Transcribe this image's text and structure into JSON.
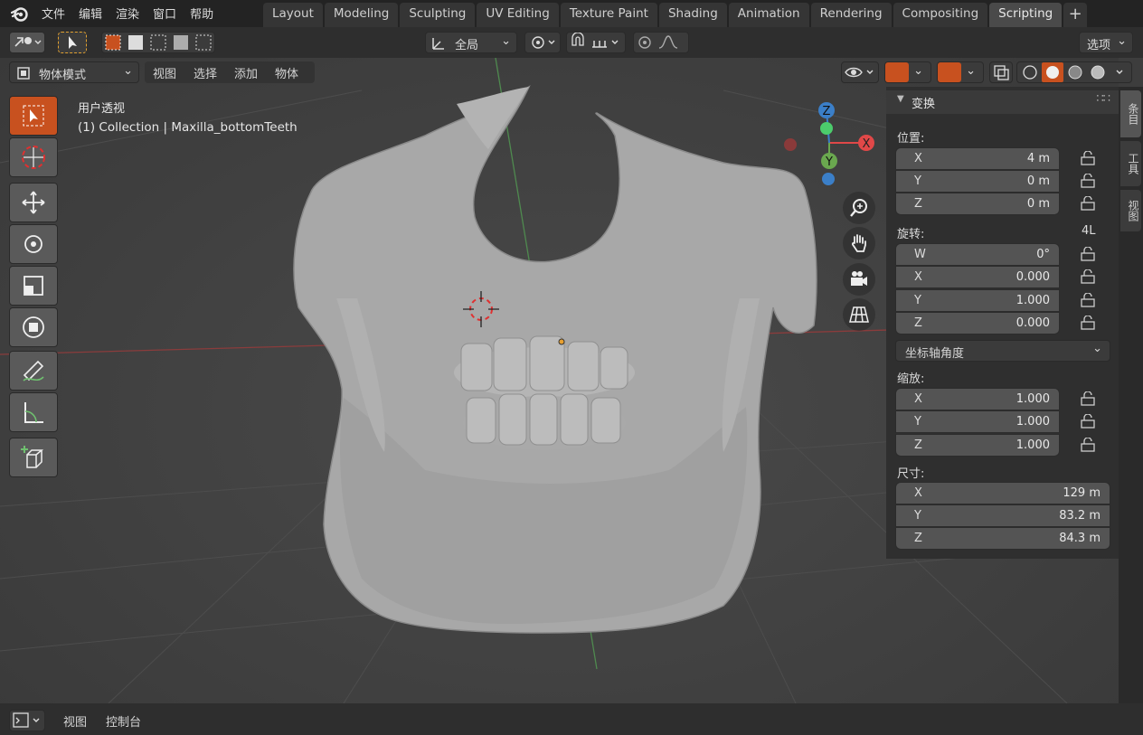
{
  "top_menu": [
    "文件",
    "编辑",
    "渲染",
    "窗口",
    "帮助"
  ],
  "workspace_tabs": [
    {
      "label": "Layout",
      "active": false
    },
    {
      "label": "Modeling",
      "active": false
    },
    {
      "label": "Sculpting",
      "active": false
    },
    {
      "label": "UV Editing",
      "active": false
    },
    {
      "label": "Texture Paint",
      "active": false
    },
    {
      "label": "Shading",
      "active": false
    },
    {
      "label": "Animation",
      "active": false
    },
    {
      "label": "Rendering",
      "active": false
    },
    {
      "label": "Compositing",
      "active": false
    },
    {
      "label": "Scripting",
      "active": true
    }
  ],
  "header": {
    "transform_orientation": "全局",
    "options_label": "选项"
  },
  "viewport_header": {
    "mode": "物体模式",
    "menus": [
      "视图",
      "选择",
      "添加",
      "物体"
    ]
  },
  "overlay": {
    "view_name": "用户透视",
    "collection_info": "(1) Collection | Maxilla_bottomTeeth"
  },
  "gizmo": {
    "x": "X",
    "y": "Y",
    "z": "Z"
  },
  "transform_panel": {
    "title": "变换",
    "location_label": "位置:",
    "location": [
      {
        "axis": "X",
        "value": "4 m"
      },
      {
        "axis": "Y",
        "value": "0 m"
      },
      {
        "axis": "Z",
        "value": "0 m"
      }
    ],
    "rotation_label": "旋转:",
    "rotation_mode_short": "4L",
    "rotation": [
      {
        "axis": "W",
        "value": "0°"
      },
      {
        "axis": "X",
        "value": "0.000"
      },
      {
        "axis": "Y",
        "value": "1.000"
      },
      {
        "axis": "Z",
        "value": "0.000"
      }
    ],
    "rotation_mode": "坐标轴角度",
    "scale_label": "缩放:",
    "scale": [
      {
        "axis": "X",
        "value": "1.000"
      },
      {
        "axis": "Y",
        "value": "1.000"
      },
      {
        "axis": "Z",
        "value": "1.000"
      }
    ],
    "dimensions_label": "尺寸:",
    "dimensions": [
      {
        "axis": "X",
        "value": "129 m"
      },
      {
        "axis": "Y",
        "value": "83.2 m"
      },
      {
        "axis": "Z",
        "value": "84.3 m"
      }
    ]
  },
  "side_tabs": [
    "条目",
    "工具",
    "视图"
  ],
  "bottom": {
    "menus": [
      "视图",
      "控制台"
    ]
  },
  "colors": {
    "accent": "#c8511f",
    "x_axis": "#e04848",
    "y_axis": "#6aa84f",
    "z_axis": "#3b7fc8"
  }
}
